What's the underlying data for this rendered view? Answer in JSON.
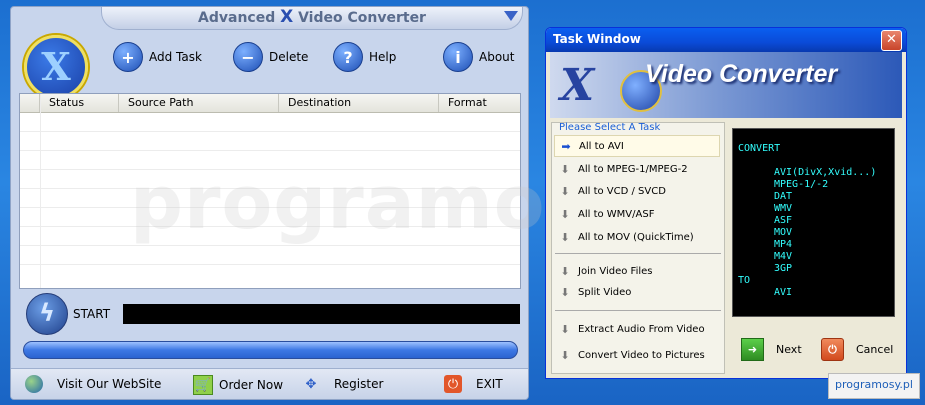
{
  "main_window": {
    "title_prefix": "Advanced ",
    "title_x": "X",
    "title_suffix": " Video Converter",
    "toolbar": {
      "add_task": "Add Task",
      "delete": "Delete",
      "help": "Help",
      "about": "About"
    },
    "table": {
      "columns": [
        "Status",
        "Source Path",
        "Destination",
        "Format"
      ],
      "rows": []
    },
    "watermark": "programosy.pl",
    "start_label": "START",
    "progress_percent": 100,
    "bottom": {
      "visit": "Visit Our WebSite",
      "order": "Order Now",
      "register": "Register",
      "exit": "EXIT"
    }
  },
  "task_window": {
    "title": "Task Window",
    "banner_title": "Video Converter",
    "banner_x": "X",
    "list_header": "Please Select A Task",
    "tasks_group1": [
      "All to AVI",
      "All to MPEG-1/MPEG-2",
      "All to VCD / SVCD",
      "All to WMV/ASF",
      "All to MOV (QuickTime)"
    ],
    "tasks_group2": [
      "Join Video Files",
      "Split Video"
    ],
    "tasks_group3": [
      "Extract Audio From Video",
      "Convert Video to Pictures"
    ],
    "selected_task": "All to AVI",
    "console": {
      "line1": "CONVERT",
      "formats": [
        "AVI(DivX,Xvid...)",
        "MPEG-1/-2",
        "DAT",
        "WMV",
        "ASF",
        "MOV",
        "MP4",
        "M4V",
        "3GP"
      ],
      "to": "TO",
      "target": "AVI"
    },
    "next_label": "Next",
    "cancel_label": "Cancel"
  },
  "brand_badge": "programosy.pl",
  "colors": {
    "desktop": "#2a86e2",
    "titlebar": "#0a4bd8",
    "console_text": "#33ffff",
    "progress": "#3d78e4"
  }
}
